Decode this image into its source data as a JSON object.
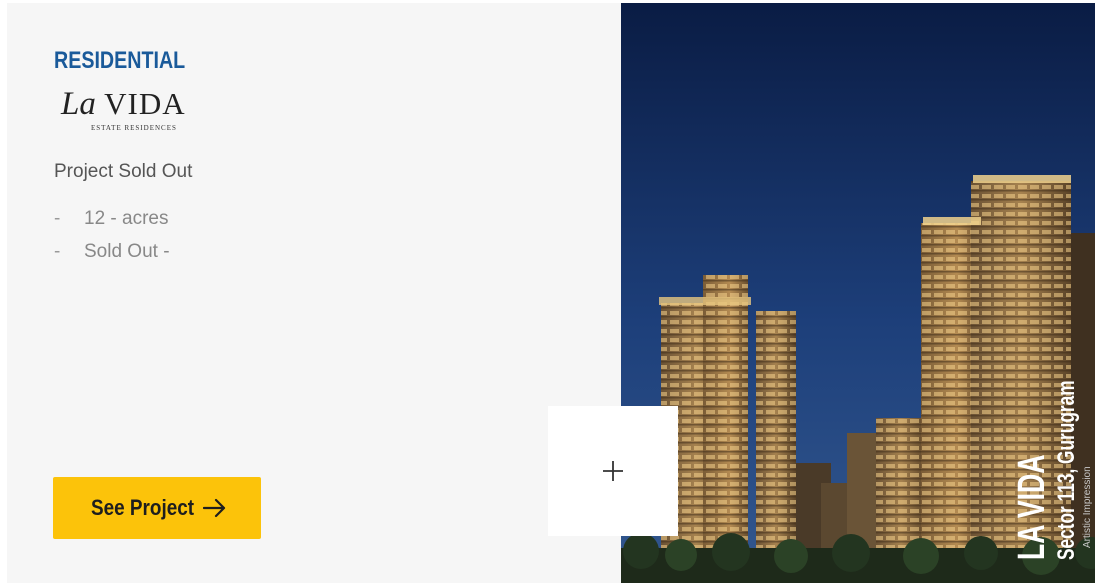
{
  "project": {
    "category": "RESIDENTIAL",
    "logo": {
      "main_la": "La",
      "main_vida": "VIDA",
      "sub": "ESTATE RESIDENCES"
    },
    "status": "Project Sold Out",
    "features": [
      {
        "bullet": "-",
        "text": "12 - acres"
      },
      {
        "bullet": "-",
        "text": "Sold Out -"
      }
    ],
    "cta": {
      "label": "See Project",
      "icon": "arrow-right-icon"
    }
  },
  "image": {
    "caption_name": "LA VIDA",
    "caption_location": "Sector 113, Gurugram",
    "caption_note": "Artistic Impression",
    "expand_icon": "plus-icon"
  },
  "colors": {
    "category": "#1a5a9a",
    "cta_bg": "#fcc30a",
    "card_bg": "#f6f6f6",
    "sky_top": "#0c1f4a",
    "sky_bottom": "#2a4f8f"
  }
}
